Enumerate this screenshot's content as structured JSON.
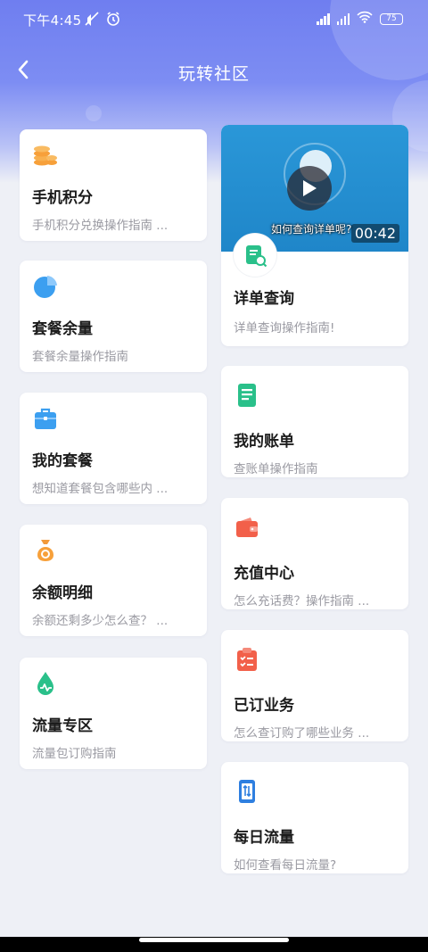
{
  "status_bar": {
    "time": "下午4:45",
    "battery": "75"
  },
  "nav": {
    "title": "玩转社区"
  },
  "left_cards": [
    {
      "icon": "coins-icon",
      "title": "手机积分",
      "desc": "手机积分兑换操作指南 ..."
    },
    {
      "icon": "pie-chart-icon",
      "title": "套餐余量",
      "desc": "套餐余量操作指南"
    },
    {
      "icon": "briefcase-icon",
      "title": "我的套餐",
      "desc": "想知道套餐包含哪些内 ..."
    },
    {
      "icon": "money-bag-icon",
      "title": "余额明细",
      "desc": "余额还剩多少怎么查？ ..."
    },
    {
      "icon": "droplet-icon",
      "title": "流量专区",
      "desc": "流量包订购指南"
    }
  ],
  "video_card": {
    "caption": "如何查询详单呢?",
    "duration": "00:42",
    "icon": "bill-search-icon",
    "title": "详单查询",
    "desc": "详单查询操作指南!"
  },
  "right_cards": [
    {
      "icon": "document-icon",
      "title": "我的账单",
      "desc": "查账单操作指南"
    },
    {
      "icon": "wallet-icon",
      "title": "充值中心",
      "desc": "怎么充话费？操作指南 ..."
    },
    {
      "icon": "clipboard-check-icon",
      "title": "已订业务",
      "desc": "怎么查订购了哪些业务 ..."
    },
    {
      "icon": "data-transfer-icon",
      "title": "每日流量",
      "desc": "如何查看每日流量?"
    }
  ],
  "colors": {
    "header": "#7080f0",
    "orange": "#f7a03a",
    "blue": "#3c9ff0",
    "green": "#2ac08a",
    "red": "#f2604a",
    "dark_blue": "#2e7fe0"
  }
}
